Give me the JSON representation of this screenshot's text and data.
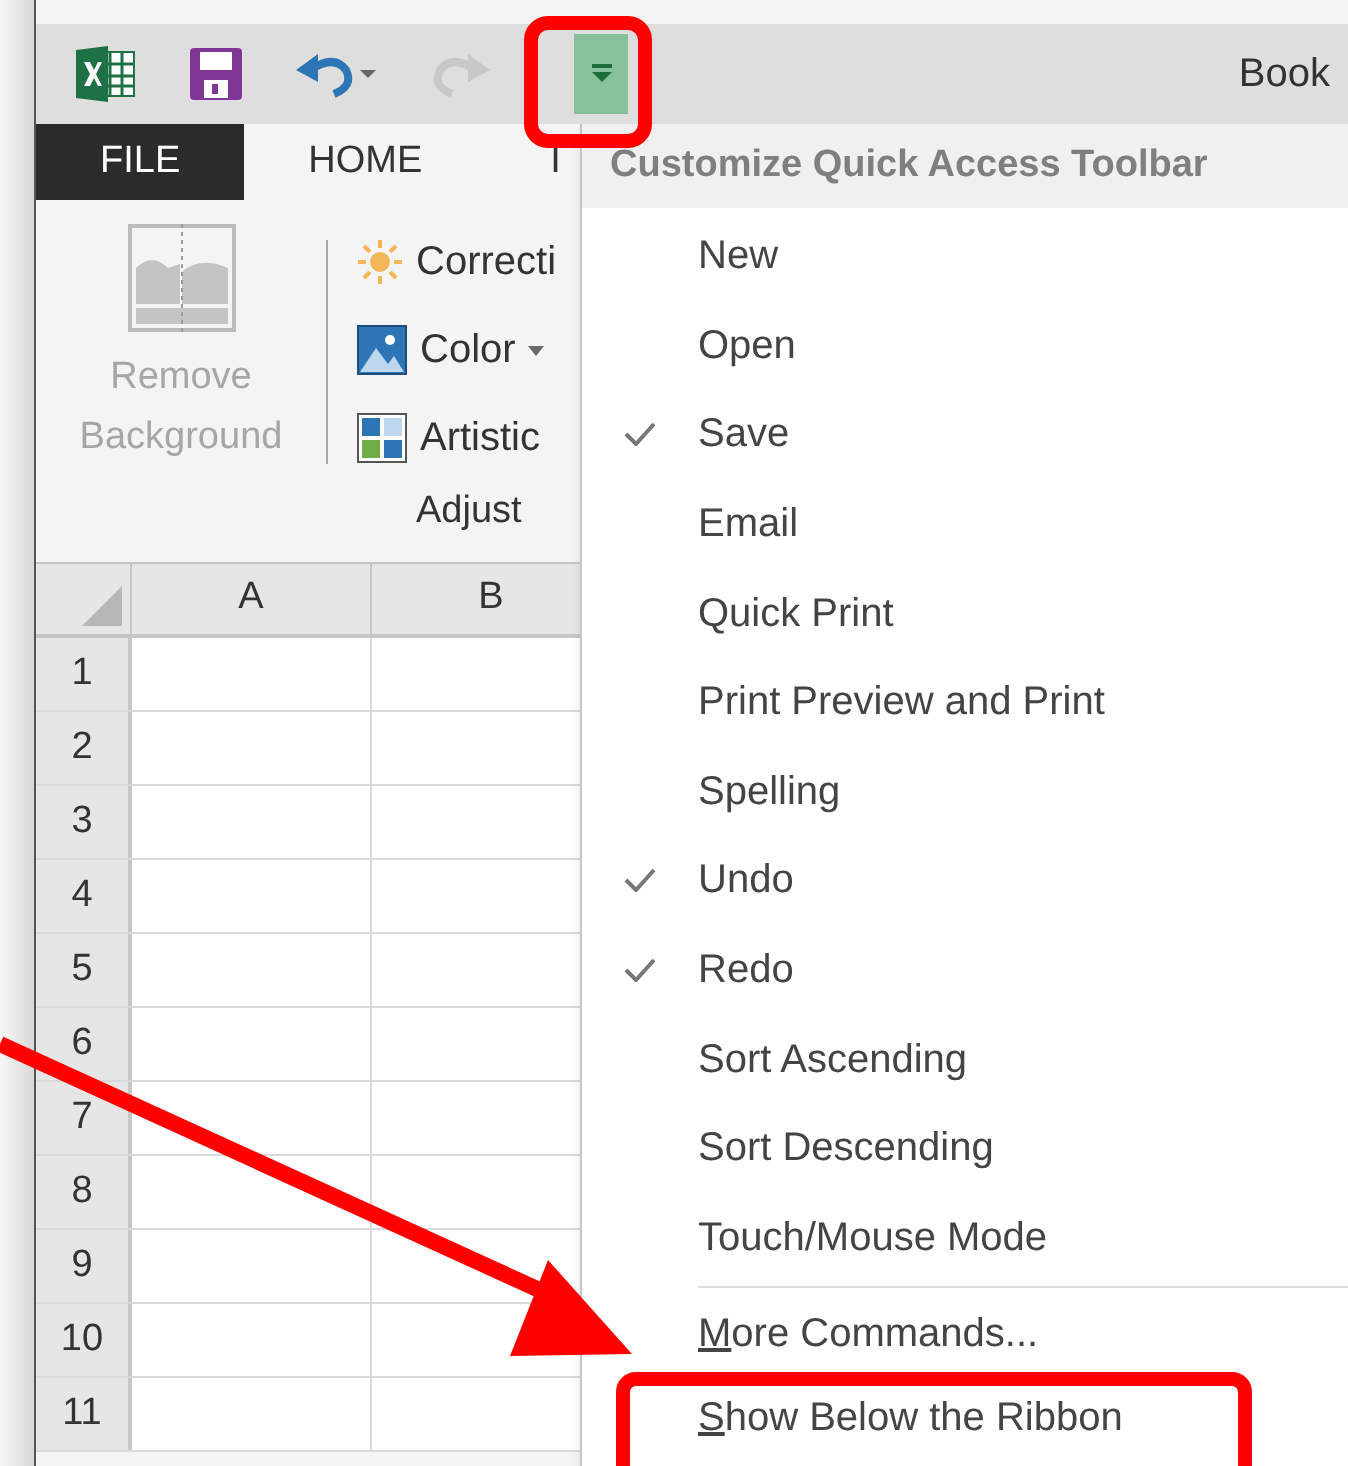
{
  "title_bar": {
    "title": "Book"
  },
  "tabs": [
    {
      "label": "FILE",
      "selected": true
    },
    {
      "label": "HOME",
      "selected": false
    },
    {
      "label": "I",
      "selected": false
    }
  ],
  "ribbon": {
    "remove_background": {
      "line_1": "Remove",
      "line_2": "Background",
      "disabled": true
    },
    "items": [
      {
        "kind": "sun",
        "label": "Correcti",
        "caret": false
      },
      {
        "kind": "picture",
        "label": "Color",
        "caret": true
      },
      {
        "kind": "artistic",
        "label": "Artistic",
        "caret": false
      }
    ],
    "group_label": "Adjust"
  },
  "sheet": {
    "columns": [
      "A",
      "B"
    ],
    "rows": [
      "1",
      "2",
      "3",
      "4",
      "5",
      "6",
      "7",
      "8",
      "9",
      "10",
      "11"
    ]
  },
  "menu": {
    "title": "Customize Quick Access Toolbar",
    "items": [
      {
        "label": "New",
        "checked": false
      },
      {
        "label": "Open",
        "checked": false
      },
      {
        "label": "Save",
        "checked": true
      },
      {
        "label": "Email",
        "checked": false
      },
      {
        "label": "Quick Print",
        "checked": false
      },
      {
        "label": "Print Preview and Print",
        "checked": false
      },
      {
        "label": "Spelling",
        "checked": false
      },
      {
        "label": "Undo",
        "checked": true
      },
      {
        "label": "Redo",
        "checked": true
      },
      {
        "label": "Sort Ascending",
        "checked": false
      },
      {
        "label": "Sort Descending",
        "checked": false
      },
      {
        "label": "Touch/Mouse Mode",
        "checked": false
      }
    ],
    "commands": [
      {
        "access_key": "M",
        "rest": "ore Commands..."
      },
      {
        "access_key": "S",
        "rest": "how Below the Ribbon"
      }
    ]
  }
}
